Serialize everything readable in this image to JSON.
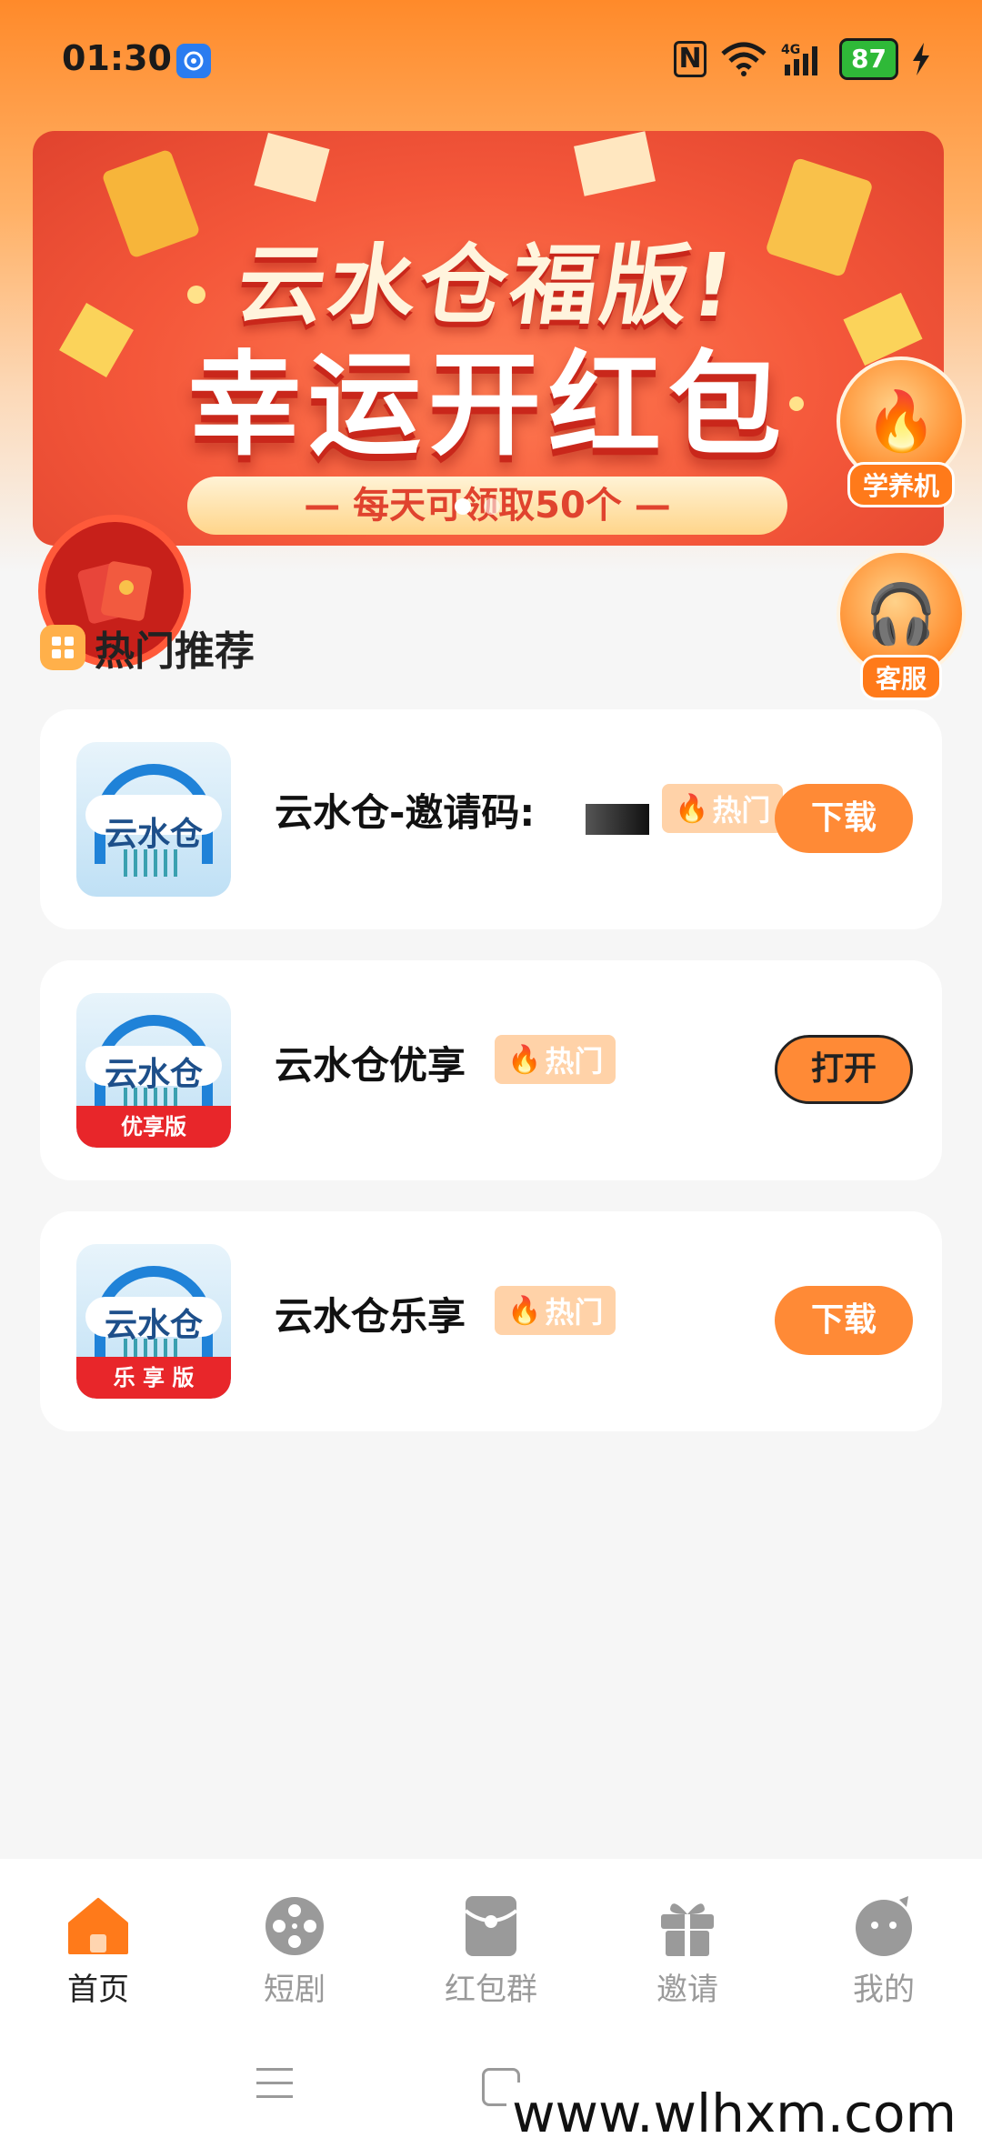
{
  "status_bar": {
    "time": "01:30",
    "battery": "87"
  },
  "banner": {
    "title_line1": "云水仓福版!",
    "title_line2": "幸运开红包",
    "subtitle": "— 每天可领取50个 —"
  },
  "floating": {
    "learn_label": "学养机",
    "service_label": "客服"
  },
  "section": {
    "title": "热门推荐"
  },
  "apps": [
    {
      "name": "云水仓-邀请码:",
      "icon_text": "云水仓",
      "ribbon": "",
      "badge": "热门",
      "button": "下载"
    },
    {
      "name": "云水仓优享",
      "icon_text": "云水仓",
      "ribbon": "优享版",
      "badge": "热门",
      "button": "打开"
    },
    {
      "name": "云水仓乐享",
      "icon_text": "云水仓",
      "ribbon": "乐 享 版",
      "badge": "热门",
      "button": "下载"
    }
  ],
  "tabs": [
    {
      "label": "首页",
      "icon": "home-icon",
      "active": true
    },
    {
      "label": "短剧",
      "icon": "film-reel-icon"
    },
    {
      "label": "红包群",
      "icon": "red-envelope-icon"
    },
    {
      "label": "邀请",
      "icon": "gift-icon"
    },
    {
      "label": "我的",
      "icon": "profile-icon"
    }
  ],
  "watermark": "www.wlhxm.com",
  "colors": {
    "accent": "#ff8a36",
    "tab_active": "#ff7a1a",
    "tab_inactive": "#9a9a9a"
  }
}
